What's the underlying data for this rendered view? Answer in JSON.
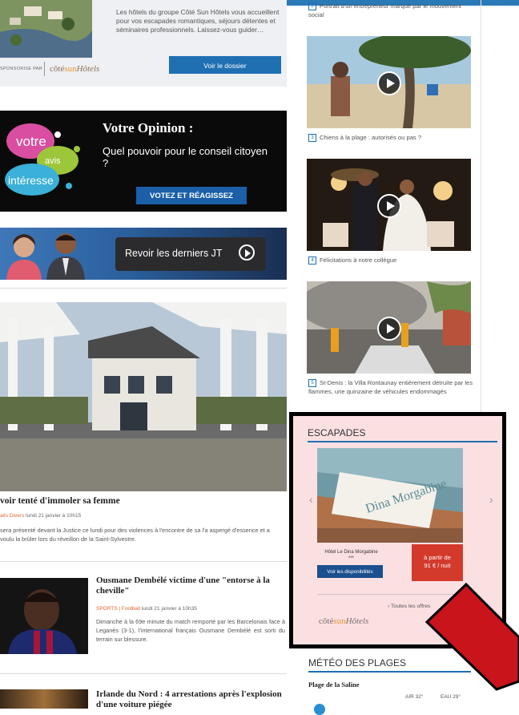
{
  "hotel_feature": {
    "text": "Les hôtels du groupe Côté Sun Hôtels vous accueillent pour vos escapades romantiques, séjours détentes et séminaires professionnels. Laissez-vous guider…",
    "sponsor_label": "SPONSORISE PAR",
    "logo_prefix": "côté",
    "logo_sun": "sun",
    "logo_suffix": "Hôtels",
    "button": "Voir le dossier"
  },
  "opinion": {
    "logo_words": [
      "votre",
      "avis",
      "intéresse"
    ],
    "title": "Votre Opinion :",
    "question": "Quel pouvoir pour le conseil citoyen ?",
    "button": "VOTEZ ET RÉAGISSEZ"
  },
  "jt_banner": {
    "label": "Revoir les derniers JT"
  },
  "articles": [
    {
      "title": "voir tenté d'immoler sa femme",
      "category": "aits Divers",
      "date": "lundi 21 janvier à 10h15",
      "excerpt": "sera présenté devant la Justice ce lundi pour des violences à l'encontre de sa l'a aspergé d'essence et a voulu la brûler lors du réveillon de la Saint-Sylvestre."
    },
    {
      "title": "Ousmane Dembélé victime d'une \"entorse à la cheville\"",
      "category": "SPORTS | Football",
      "date": "lundi 21 janvier à 10h35",
      "excerpt": "Dimanche à la 69e minute du match remporté par les Barcelonais face à Leganés (3-1), l'international français Ousmane Dembélé est sorti du terrain sur blessure."
    },
    {
      "title": "Irlande du Nord : 4 arrestations après l'explosion d'une voiture piégée"
    }
  ],
  "videos": [
    {
      "num": "2",
      "caption": "Portrait d'un entrepreneur marqué par le mouvement social"
    },
    {
      "num": "3",
      "caption": "Chiens à la plage : autorisés ou pas ?"
    },
    {
      "num": "4",
      "caption": "Félicitations à notre collègue"
    },
    {
      "num": "5",
      "caption": "St-Denis : la Villa Rontaunay entièrement détruite par les flammes, une quinzaine de véhicules endommagés"
    }
  ],
  "escapades": {
    "title": "ESCAPADES",
    "slide_text": "Dina Morgabine",
    "hotel_name": "Hôtel Le Dina Morgabine",
    "stars": "***",
    "button": "Voir les disponibilités",
    "price_line1": "à partir de",
    "price_line2": "91 € / nuit",
    "link": "Toutes les offres",
    "logo_prefix": "côté",
    "logo_sun": "sun",
    "logo_suffix": "Hôtels"
  },
  "meteo": {
    "title": "MÉTÉO DES PLAGES",
    "place": "Plage de la Saline",
    "air": "AIR 32°",
    "eau": "EAU 29°"
  },
  "colors": {
    "accent": "#1f6fb3",
    "price": "#d33a2c",
    "escapades_bg": "#fbe0e2",
    "annotation_arrow": "#d11a1a"
  }
}
